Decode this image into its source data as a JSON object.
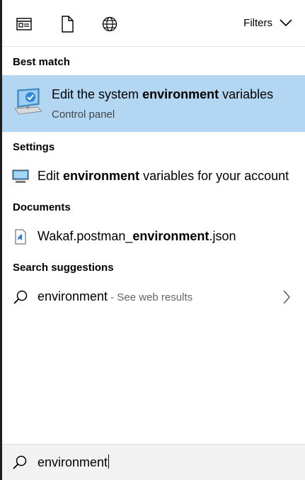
{
  "toolbar": {
    "icons": [
      "apps-icon",
      "document-icon",
      "web-icon"
    ],
    "filters_label": "Filters"
  },
  "best_match": {
    "header": "Best match",
    "title_pre": "Edit the system ",
    "title_bold": "environment",
    "title_post": " variables",
    "subtitle": "Control panel",
    "accent": "#b3d7f3"
  },
  "settings": {
    "header": "Settings",
    "item_pre": "Edit ",
    "item_bold": "environment",
    "item_post": " variables for your account"
  },
  "documents": {
    "header": "Documents",
    "item_pre": "Wakaf.postman_",
    "item_bold": "environment",
    "item_post": ".json"
  },
  "suggestions": {
    "header": "Search suggestions",
    "query": "environment",
    "hint": " - See web results"
  },
  "search": {
    "value": "environment"
  }
}
